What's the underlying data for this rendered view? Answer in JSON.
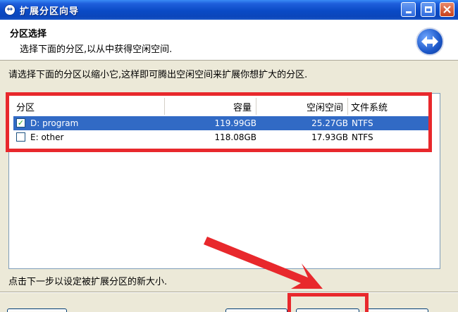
{
  "window": {
    "title": "扩展分区向导",
    "controls": [
      "minimize",
      "maximize",
      "close"
    ]
  },
  "header": {
    "title": "分区选择",
    "subtitle": "选择下面的分区,以从中获得空闲空间."
  },
  "main": {
    "instruction": "请选择下面的分区以缩小它,这样即可腾出空闲空间来扩展你想扩大的分区.",
    "columns": [
      "分区",
      "容量",
      "空闲空间",
      "文件系统"
    ],
    "rows": [
      {
        "name": "D: program",
        "size": "119.99GB",
        "free": "25.27GB",
        "fs": "NTFS",
        "checked": true,
        "selected": true
      },
      {
        "name": "E: other",
        "size": "118.08GB",
        "free": "17.93GB",
        "fs": "NTFS",
        "checked": false,
        "selected": false
      }
    ]
  },
  "footer": {
    "hint": "点击下一步以设定被扩展分区的新大小."
  },
  "colors": {
    "titlebar": "#0a4ac6",
    "selection": "#316ac5",
    "annotation": "#e8282c",
    "dialog_bg": "#ece9d8"
  },
  "icons": [
    "app-icon",
    "minimize-icon",
    "maximize-icon",
    "close-icon",
    "wizard-logo-icon",
    "checkbox-checked-icon",
    "checkbox-unchecked-icon",
    "annotation-arrow"
  ]
}
